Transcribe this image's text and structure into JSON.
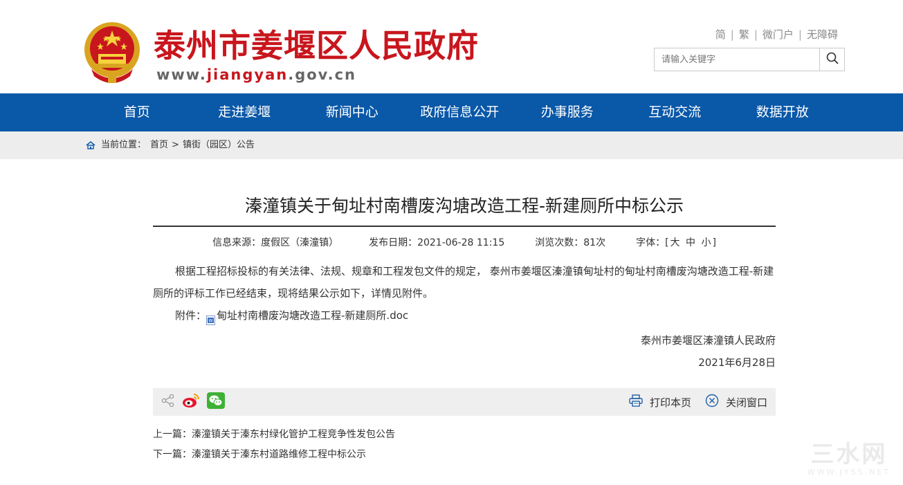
{
  "header": {
    "site_title": "泰州市姜堰区人民政府",
    "url_prefix": "www.",
    "url_highlight": "jiangyan",
    "url_suffix": ".gov.cn",
    "top_links": [
      "简",
      "繁",
      "微门户",
      "无障碍"
    ],
    "search_placeholder": "请输入关键字"
  },
  "nav": {
    "items": [
      "首页",
      "走进姜堰",
      "新闻中心",
      "政府信息公开",
      "办事服务",
      "互动交流",
      "数据开放"
    ]
  },
  "breadcrumb": {
    "label": "当前位置：",
    "home": "首页",
    "separator": ">",
    "current": "镇街（园区）公告"
  },
  "article": {
    "title": "溱潼镇关于甸址村南槽废沟塘改造工程-新建厕所中标公示",
    "source": "信息来源：度假区（溱潼镇）",
    "date": "发布日期：2021-06-28 11:15",
    "views": "浏览次数：81次",
    "font_label": "字体：[",
    "font_large": "大",
    "font_medium": "中",
    "font_small": "小",
    "font_end": "]",
    "paragraph": "根据工程招标投标的有关法律、法规、规章和工程发包文件的规定， 泰州市姜堰区溱潼镇甸址村的甸址村南槽废沟塘改造工程-新建厕所的评标工作已经结束，现将结果公示如下，详情见附件。",
    "attach_label": "附件：",
    "attach_file": "甸址村南槽废沟塘改造工程-新建厕所.doc",
    "signature": "泰州市姜堰区溱潼镇人民政府",
    "sign_date": "2021年6月28日"
  },
  "share_bar": {
    "print": "打印本页",
    "close": "关闭窗口"
  },
  "prevnext": {
    "prev_label": "上一篇：",
    "prev_title": "溱潼镇关于溱东村绿化管护工程竞争性发包公告",
    "next_label": "下一篇：",
    "next_title": "溱潼镇关于溱东村道路维修工程中标公示"
  },
  "watermark": {
    "big": "三水网",
    "small": "WWW.JYSS.NET"
  },
  "colors": {
    "brand_red": "#c8161d",
    "nav_blue": "#0a58a8"
  }
}
